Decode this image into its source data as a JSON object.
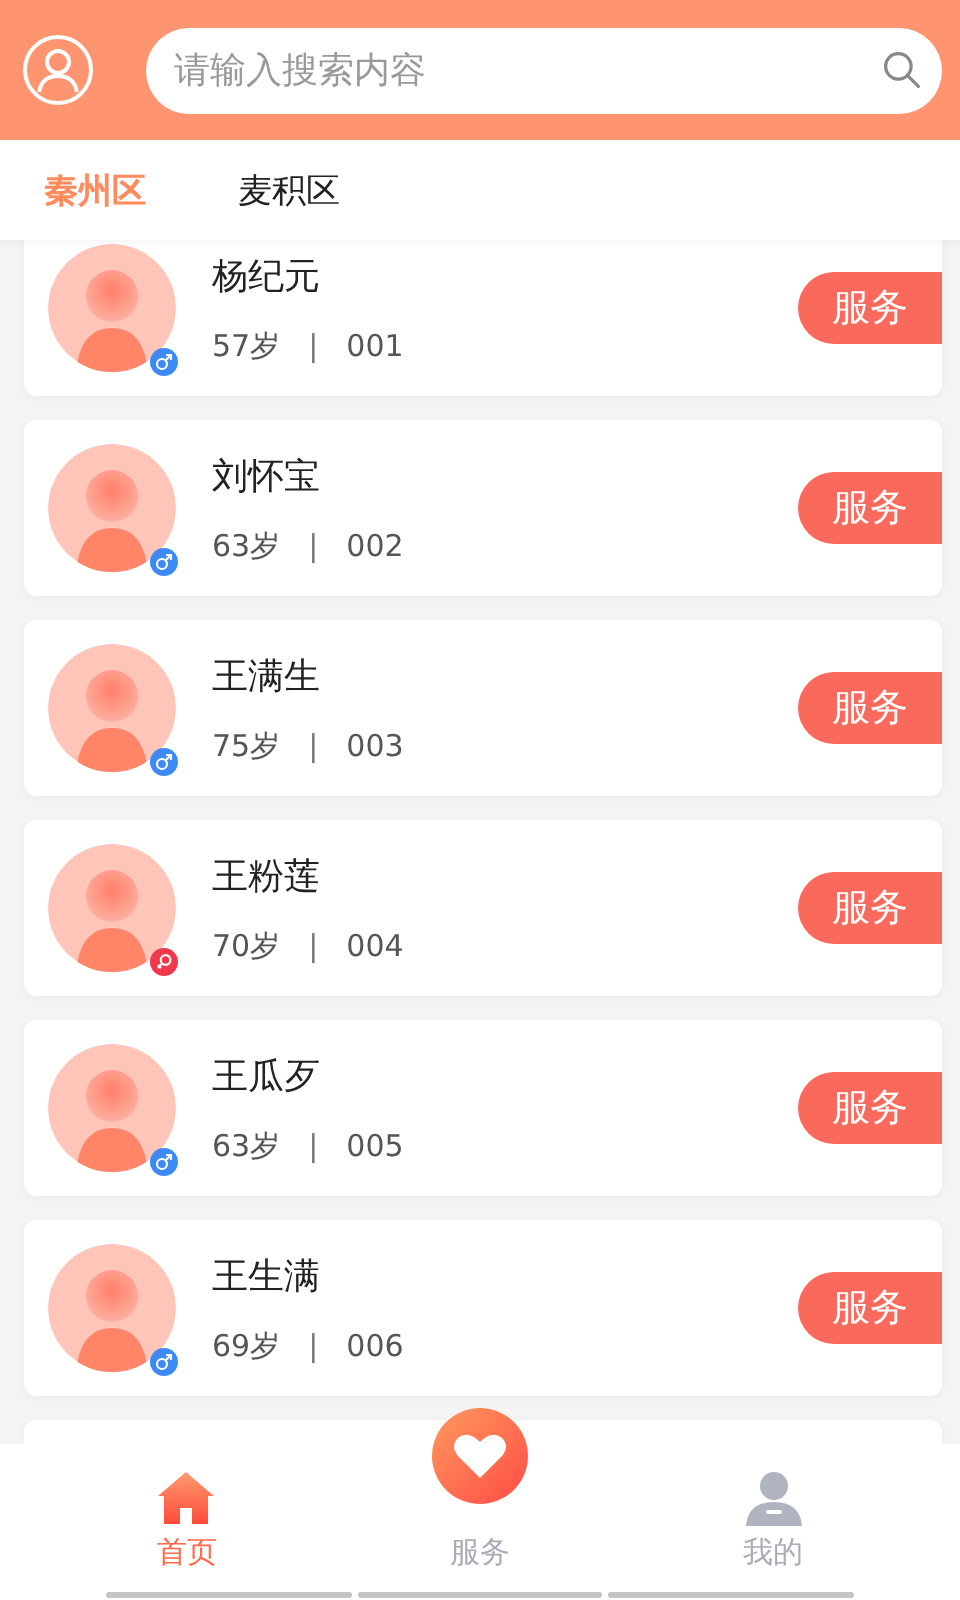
{
  "search": {
    "placeholder": "请输入搜索内容"
  },
  "tabs": [
    {
      "label": "秦州区",
      "selected": true
    },
    {
      "label": "麦积区",
      "selected": false
    }
  ],
  "people": [
    {
      "name": "杨纪元",
      "age": "57岁",
      "separator": "|",
      "number": "001",
      "female": false,
      "action": "服务"
    },
    {
      "name": "刘怀宝",
      "age": "63岁",
      "separator": "|",
      "number": "002",
      "female": false,
      "action": "服务"
    },
    {
      "name": "王满生",
      "age": "75岁",
      "separator": "|",
      "number": "003",
      "female": false,
      "action": "服务"
    },
    {
      "name": "王粉莲",
      "age": "70岁",
      "separator": "|",
      "number": "004",
      "female": true,
      "action": "服务"
    },
    {
      "name": "王瓜歹",
      "age": "63岁",
      "separator": "|",
      "number": "005",
      "female": false,
      "action": "服务"
    },
    {
      "name": "王生满",
      "age": "69岁",
      "separator": "|",
      "number": "006",
      "female": false,
      "action": "服务"
    }
  ],
  "bottom_nav": [
    {
      "label": "首页",
      "kind": "home",
      "selected": true
    },
    {
      "label": "服务",
      "kind": "service",
      "selected": false
    },
    {
      "label": "我的",
      "kind": "profile",
      "selected": false
    }
  ]
}
